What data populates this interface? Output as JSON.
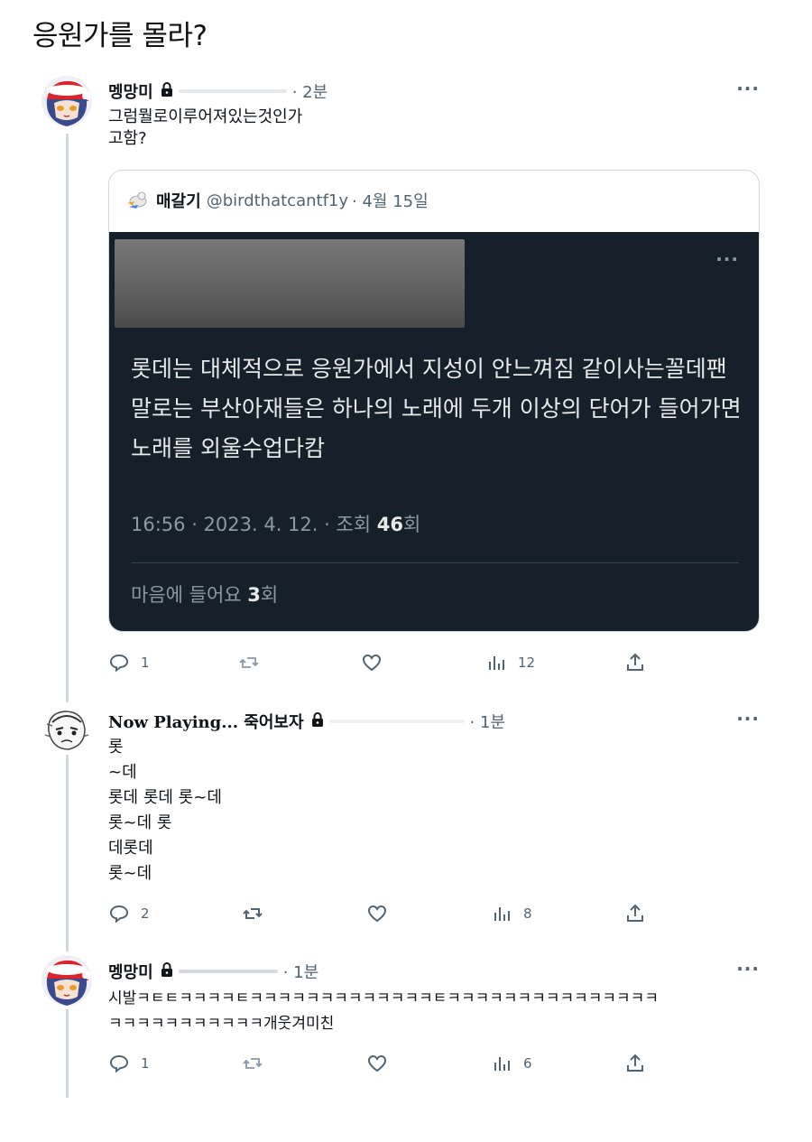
{
  "page": {
    "title": "응원가를 몰라?"
  },
  "tweets": [
    {
      "name": "멩망미",
      "time": "· 2분",
      "text": "그럼뭘로이루어져있는것인가\n고함?",
      "more": "···",
      "quote": {
        "name": "매갈기",
        "handle": "@birdthatcantf1y",
        "time": "· 4월 15일",
        "screenshot": {
          "more": "···",
          "text": "롯데는 대체적으로 응원가에서 지성이 안느껴짐 같이사는꼴데팬말로는 부산아재들은 하나의 노래에 두개 이상의 단어가 들어가면 노래를 외울수업다캄",
          "meta_prefix": "16:56 · 2023. 4. 12. · 조회 ",
          "views": "46",
          "views_suffix": "회",
          "likes_prefix": "마음에 들어요 ",
          "likes": "3",
          "likes_suffix": "회"
        }
      },
      "actions": {
        "reply": "1",
        "retweet": "",
        "like": "",
        "views": "12"
      }
    },
    {
      "name": "Now Playing... 죽어보자",
      "time": "· 1분",
      "text": "롯\n~데\n롯데 롯데 롯~데\n롯~데 롯\n데롯데\n롯~데",
      "more": "···",
      "actions": {
        "reply": "2",
        "retweet": "",
        "like": "",
        "views": "8"
      }
    },
    {
      "name": "멩망미",
      "time": "· 1분",
      "text": "시발ㅋㅌㅌㅋㅋㅋㅋㅌㅋㅋㅋㅋㅋㅋㅋㅋㅋㅋㅋㅋㅋㅌㅋㅋㅋㅋㅋㅋㅋㅋㅋㅋㅋㅋㅋㅋㅋ\nㅋㅋㅋㅋㅋㅋㅋㅋㅋㅋㅋ개웃겨미친",
      "more": "···",
      "actions": {
        "reply": "1",
        "retweet": "",
        "like": "",
        "views": "6"
      }
    }
  ],
  "icons": [
    "lock-icon",
    "reply-icon",
    "retweet-icon",
    "like-icon",
    "views-icon",
    "share-icon",
    "more-icon"
  ],
  "colors": {
    "dark_bg": "#15202b",
    "muted": "#536471",
    "border": "#cfd9de"
  }
}
